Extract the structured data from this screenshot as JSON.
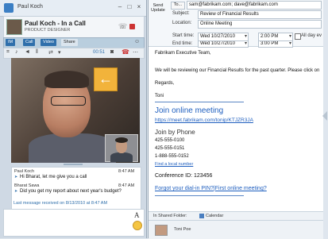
{
  "lync": {
    "window_title": "Paul Koch",
    "contact_name": "Paul Koch - In a Call",
    "contact_role": "PRODUCT DESIGNER",
    "toolbar": {
      "im": "IM",
      "call": "Call",
      "video": "Video",
      "share": "Share"
    },
    "timer": "00:51",
    "chat": {
      "messages": [
        {
          "sender": "Paul Koch",
          "time": "8:47 AM",
          "text": "Hi Bharat, let me give you a call"
        },
        {
          "sender": "Bharat Sawa",
          "time": "8:47 AM",
          "text": "Did you get my report about next year's budget?"
        }
      ],
      "status": "Last message received on 8/13/2010 at 8:47 AM"
    },
    "font_button": "A"
  },
  "outlook": {
    "send_label": "Send\nUpdate",
    "to_label": "To...",
    "to_value": "sam@fabrikam.com; dave@fabrikam.com",
    "subject_label": "Subject:",
    "subject_value": "Review of Financial Results",
    "location_label": "Location:",
    "location_value": "Online Meeting",
    "start_label": "Start time:",
    "start_date": "Wed 10/27/2010",
    "start_time": "2:00 PM",
    "end_label": "End time:",
    "end_date": "Wed 10/27/2010",
    "end_time": "3:00 PM",
    "all_day": "All day ev",
    "body": {
      "greeting": "Fabrikam Executive Team,",
      "line1": "We will be reviewing our Financial Results for the past quarter. Please click on",
      "regards": "Regards,",
      "signature": "Toni",
      "join_title": "Join online meeting",
      "join_url": "https://meet.fabrikam.com/tonip/KTJZR3JA",
      "phone_title": "Join by Phone",
      "phone1": "425-555-0100",
      "phone2": "425-555-0151",
      "phone3": "1-888-555-0152",
      "find_local": "Find a local number",
      "conf_id": "Conference ID: 123456",
      "forgot_pin": "Forgot your dial-in PIN?",
      "separator": "|",
      "first_meeting": "First online meeting?"
    },
    "footer": {
      "shared_folder_label": "In Shared Folder:",
      "calendar": "Calendar",
      "attendee": "Toni Poe"
    }
  }
}
